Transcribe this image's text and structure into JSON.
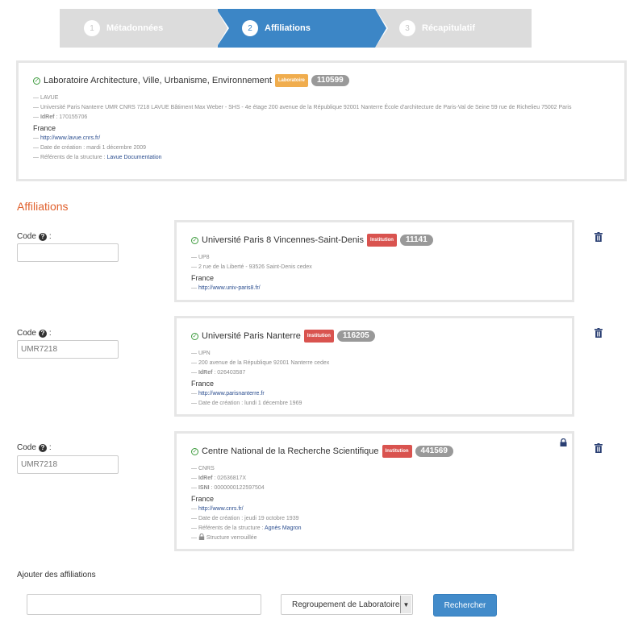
{
  "stepper": {
    "steps": [
      {
        "num": "1",
        "label": "Métadonnées",
        "state": "done"
      },
      {
        "num": "2",
        "label": "Affiliations",
        "state": "active"
      },
      {
        "num": "3",
        "label": "Récapitulatif",
        "state": "todo"
      }
    ]
  },
  "lab": {
    "name": "Laboratoire Architecture, Ville, Urbanisme, Environnement",
    "type": "Laboratoire",
    "id": "110599",
    "acronym": "— LAVUE",
    "address": "— Université Paris Nanterre UMR CNRS 7218 LAVUE Bâtiment Max Weber - SHS - 4e étage 200 avenue de la République 92001 Nanterre École d'architecture de Paris-Val de Seine 59 rue de Richelieu 75002 Paris",
    "idref_prefix": "— ",
    "idref_label": "IdRef",
    "idref_value": " : 170155706",
    "country": "France",
    "url_prefix": "— ",
    "url": "http://www.lavue.cnrs.fr/",
    "creation": "— Date de création : mardi 1 décembre 2009",
    "referents_prefix": "— Référents de la structure : ",
    "referents": "Lavue Documentation"
  },
  "affiliations": {
    "section_title": "Affiliations",
    "code_label": "Code",
    "code_colon": " :",
    "items": [
      {
        "code_value": "",
        "name": "Université Paris 8 Vincennes-Saint-Denis",
        "type": "Institution",
        "id": "11141",
        "acronym": "— UP8",
        "address": "— 2 rue de la Liberté - 93526 Saint-Denis cedex",
        "country": "France",
        "url_prefix": "— ",
        "url": "http://www.univ-paris8.fr/"
      },
      {
        "code_value": "UMR7218",
        "name": "Université Paris Nanterre",
        "type": "Institution",
        "id": "116205",
        "acronym": "— UPN",
        "address": "— 200 avenue de la République 92001 Nanterre cedex",
        "idref_prefix": "— ",
        "idref_label": "IdRef",
        "idref_value": " : 026403587",
        "country": "France",
        "url_prefix": "— ",
        "url": "http://www.parisnanterre.fr",
        "creation": "— Date de création : lundi 1 décembre 1969"
      },
      {
        "code_value": "UMR7218",
        "name": "Centre National de la Recherche Scientifique",
        "type": "Institution",
        "id": "441569",
        "acronym": "— CNRS",
        "idref_prefix": "— ",
        "idref_label": "IdRef",
        "idref_value": " : 02636817X",
        "isni_label": "ISNI",
        "isni_value": " : 0000000122597504",
        "country": "France",
        "url_prefix": "— ",
        "url": "http://www.cnrs.fr/",
        "creation": "— Date de création : jeudi 19 octobre 1939",
        "referents_prefix": "— Référents de la structure : ",
        "referents": "Agnès Magron",
        "locked_text": "Structure verrouillée"
      }
    ]
  },
  "add": {
    "title": "Ajouter des affiliations",
    "search_value": "",
    "select_value": "Regroupement de Laboratoires",
    "search_button": "Rechercher"
  },
  "colors": {
    "stepper_active": "#3c86c6",
    "stepper_inactive": "#dcdcdc",
    "badge_laboratoire": "#f0ad4e",
    "badge_institution": "#d9534f",
    "badge_id": "#999999",
    "section_title": "#e0612e",
    "button_primary": "#428bca"
  }
}
